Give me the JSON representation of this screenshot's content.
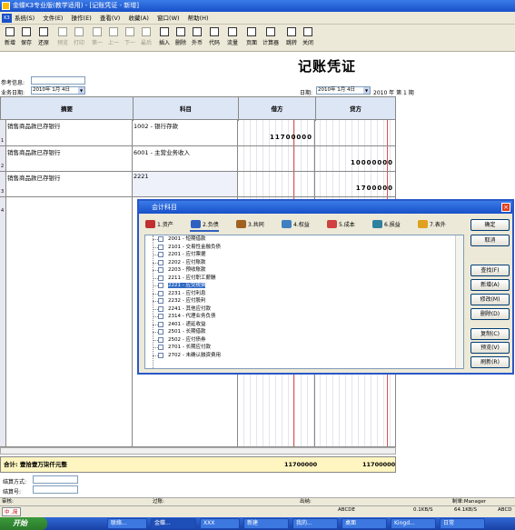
{
  "window": {
    "title": "金蝶K3专业版(教学适用) - [记账凭证 - 新增]"
  },
  "menu": {
    "items": [
      "系统(S)",
      "文件(E)",
      "操作(E)",
      "查看(V)",
      "收藏(A)",
      "窗口(W)",
      "帮助(H)"
    ]
  },
  "toolbar": {
    "buttons": [
      {
        "label": "新增",
        "disabled": false
      },
      {
        "label": "保存",
        "disabled": false
      },
      {
        "label": "还原",
        "disabled": false
      },
      {
        "label": "预览",
        "disabled": true
      },
      {
        "label": "打印",
        "disabled": true
      },
      {
        "label": "第一",
        "disabled": true
      },
      {
        "label": "上一",
        "disabled": true
      },
      {
        "label": "下一",
        "disabled": true
      },
      {
        "label": "最后",
        "disabled": true
      },
      {
        "label": "插入",
        "disabled": false
      },
      {
        "label": "删除",
        "disabled": false
      },
      {
        "label": "外币",
        "disabled": false
      },
      {
        "label": "代码",
        "disabled": false
      },
      {
        "label": "流量",
        "disabled": false
      },
      {
        "label": "页面",
        "disabled": false
      },
      {
        "label": "计算器",
        "disabled": false
      },
      {
        "label": "跳转",
        "disabled": false
      },
      {
        "label": "关闭",
        "disabled": false
      }
    ]
  },
  "voucher": {
    "title": "记账凭证",
    "ref_label": "参考信息:",
    "ref_value": "",
    "biz_date_label": "业务日期:",
    "biz_date": "2010年 1月 4日",
    "date_label": "日期:",
    "date": "2010年 1月 4日",
    "period": "2010 年 第 1 期",
    "headers": {
      "summary": "摘要",
      "account": "科目",
      "debit": "借方",
      "credit": "贷方"
    },
    "rows": [
      {
        "num": "1",
        "summary": "销售商品款已存银行",
        "account": "1002 - 银行存款",
        "debit": "11700000",
        "credit": ""
      },
      {
        "num": "2",
        "summary": "销售商品款已存银行",
        "account": "6001 - 主营业务收入",
        "debit": "",
        "credit": "10000000"
      },
      {
        "num": "3",
        "summary": "销售商品款已存银行",
        "account": "2221",
        "debit": "",
        "credit": "1700000"
      },
      {
        "num": "4",
        "summary": "",
        "account": "",
        "debit": "",
        "credit": ""
      }
    ],
    "total_label": "合计: 壹拾壹万柒仟元整",
    "total_debit": "11700000",
    "total_credit": "11700000",
    "settle_method_label": "结算方式:",
    "settle_no_label": "结算号:",
    "footer": {
      "audit": "审核:",
      "posting": "过账:",
      "cashier": "出纳:",
      "preparer": "制单:Manager"
    }
  },
  "dialog": {
    "title": "会计科目",
    "tabs": [
      {
        "label": "1.资产",
        "color": "#c03030"
      },
      {
        "label": "2.负债",
        "color": "#3060c0"
      },
      {
        "label": "3.共同",
        "color": "#a06020"
      },
      {
        "label": "4.权益",
        "color": "#4080c0"
      },
      {
        "label": "5.成本",
        "color": "#d04040"
      },
      {
        "label": "6.损益",
        "color": "#3080a0"
      },
      {
        "label": "7.表外",
        "color": "#e0a020"
      }
    ],
    "items": [
      {
        "label": "2001 - 短期借款",
        "selected": false
      },
      {
        "label": "2101 - 交易性金融负债",
        "selected": false
      },
      {
        "label": "2201 - 应付票据",
        "selected": false
      },
      {
        "label": "2202 - 应付账款",
        "selected": false
      },
      {
        "label": "2203 - 预收账款",
        "selected": false
      },
      {
        "label": "2211 - 应付职工薪酬",
        "selected": false
      },
      {
        "label": "2221 - 应交税费",
        "selected": true
      },
      {
        "label": "2231 - 应付利息",
        "selected": false
      },
      {
        "label": "2232 - 应付股利",
        "selected": false
      },
      {
        "label": "2241 - 其他应付款",
        "selected": false
      },
      {
        "label": "2314 - 代理业务负债",
        "selected": false
      },
      {
        "label": "2401 - 递延收益",
        "selected": false
      },
      {
        "label": "2501 - 长期借款",
        "selected": false
      },
      {
        "label": "2502 - 应付债券",
        "selected": false
      },
      {
        "label": "2701 - 长期应付款",
        "selected": false
      },
      {
        "label": "2702 - 未确认融资费用",
        "selected": false
      }
    ],
    "buttons": {
      "ok": "确定",
      "cancel": "取消",
      "find": "查找(F)",
      "add": "新增(A)",
      "modify": "修改(M)",
      "delete": "删除(D)",
      "copy": "复制(C)",
      "preview": "预览(V)",
      "refresh": "刷新(R)"
    }
  },
  "statusbar": {
    "center": "ABCDE",
    "upload": "0.1KB/S",
    "download": "64.1KB/S",
    "right": "ABCD"
  },
  "ime": {
    "text": "中 ,简"
  },
  "taskbar": {
    "start": "开始",
    "tasks": [
      "联络...",
      "金蝶...",
      "XXX",
      "新建",
      "我的...",
      "桌面",
      "Kingd...",
      "日常"
    ]
  }
}
